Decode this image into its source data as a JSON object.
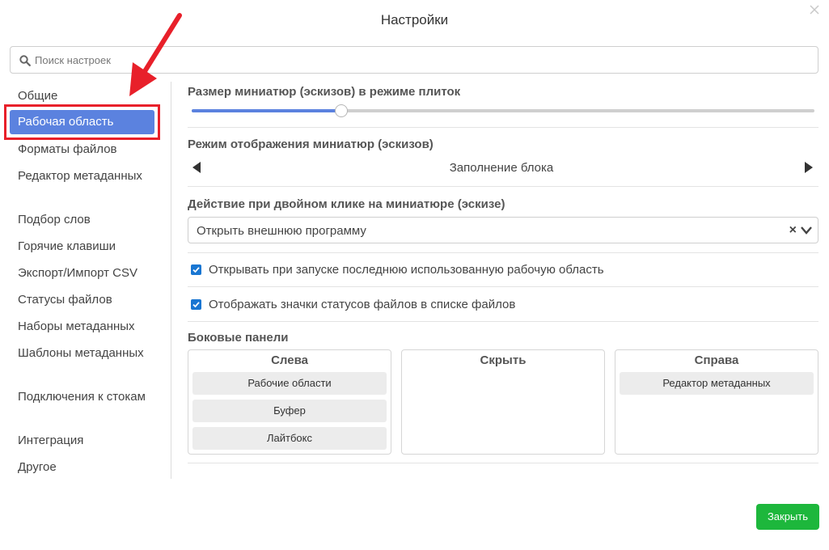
{
  "dialog": {
    "title": "Настройки",
    "close_icon": "close-icon"
  },
  "search": {
    "placeholder": "Поиск настроек",
    "value": "",
    "icon": "search-icon"
  },
  "sidebar": {
    "items": [
      {
        "label": "Общие"
      },
      {
        "label": "Рабочая область"
      },
      {
        "label": "Форматы файлов"
      },
      {
        "label": "Редактор метаданных"
      },
      {
        "label": "Подбор слов"
      },
      {
        "label": "Горячие клавиши"
      },
      {
        "label": "Экспорт/Импорт CSV"
      },
      {
        "label": "Статусы файлов"
      },
      {
        "label": "Наборы метаданных"
      },
      {
        "label": "Шаблоны метаданных"
      },
      {
        "label": "Подключения к стокам"
      },
      {
        "label": "Интеграция"
      },
      {
        "label": "Другое"
      }
    ],
    "active_index": 1,
    "annotation": {
      "highlight_color": "#e8202a",
      "arrow_color": "#e8202a"
    }
  },
  "thumbnail_size": {
    "label": "Размер миниатюр (эскизов) в режиме плиток",
    "value_fraction": 0.24
  },
  "thumbnail_mode": {
    "label": "Режим отображения миниатюр (эскизов)",
    "value": "Заполнение блока"
  },
  "double_click": {
    "label": "Действие при двойном клике на миниатюре (эскизе)",
    "value": "Открыть внешнюю программу",
    "clear_glyph": "×"
  },
  "checkboxes": [
    {
      "label": "Открывать при запуске последнюю использованную рабочую область",
      "checked": true
    },
    {
      "label": "Отображать значки статусов файлов в списке файлов",
      "checked": true
    }
  ],
  "side_panels": {
    "label": "Боковые панели",
    "columns": [
      {
        "title": "Слева",
        "items": [
          "Рабочие области",
          "Буфер",
          "Лайтбокс"
        ]
      },
      {
        "title": "Скрыть",
        "items": []
      },
      {
        "title": "Справа",
        "items": [
          "Редактор метаданных"
        ]
      }
    ]
  },
  "footer": {
    "close_label": "Закрыть"
  },
  "colors": {
    "accent": "#5b82df",
    "checkbox": "#1976d2",
    "primary_button": "#1db73c"
  }
}
